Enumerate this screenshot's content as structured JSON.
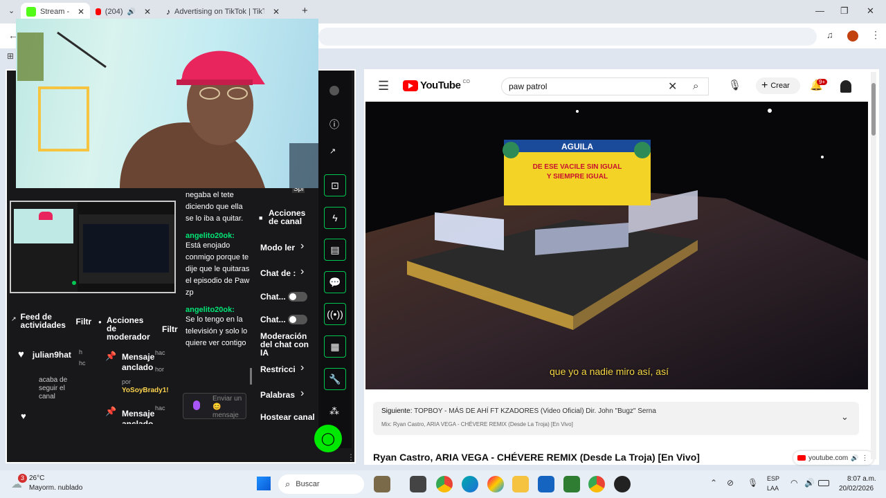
{
  "browser": {
    "tabs": [
      {
        "label": "Stream -"
      },
      {
        "label": "(204)"
      },
      {
        "label": "Advertising on TikTok | TikTok A"
      }
    ],
    "new_tab": "+"
  },
  "webcam_overlay": {
    "cap_color": "#e8255d"
  },
  "stream_panel": {
    "chat_messages_top": "negaba el tete diciendo que ella se lo iba a quitar.",
    "chat": [
      {
        "user": "angelito20ok:",
        "text": "Está enojado conmigo porque te dije que le quitaras el episodio de Paw zp"
      },
      {
        "user": "angelito20ok:",
        "text": "Se lo tengo en la televisión y solo lo quiere ver contigo"
      }
    ],
    "chat_placeholder": "Enviar un 😊 mensaje",
    "activity_feed": {
      "title": "Feed de actividades",
      "filter": "Filtr",
      "user": "julian9hat",
      "time": "h",
      "time2": "hc",
      "action": "acaba de seguir el canal"
    },
    "mod_actions": {
      "title": "Acciones de moderador",
      "filter": "Filtr",
      "items": [
        {
          "label": "Mensaje anclado",
          "time": "hac",
          "time2": "hor",
          "by": "por",
          "by_user": "YoSoyBrady1!"
        },
        {
          "label": "Mensaje anclado",
          "time": "hac"
        }
      ]
    },
    "channel_actions": {
      "title": "Acciones de canal",
      "items": [
        {
          "label": "Modo ler",
          "type": "arrow"
        },
        {
          "label": "Chat de :",
          "type": "arrow"
        },
        {
          "label": "Chat...",
          "type": "toggle"
        },
        {
          "label": "Chat...",
          "type": "toggle"
        },
        {
          "label": "Moderación del chat con IA",
          "type": "none"
        },
        {
          "label": "Restricci",
          "type": "arrow"
        },
        {
          "label": "Palabras",
          "type": "arrow"
        },
        {
          "label": "Hostear canal",
          "type": "none"
        }
      ]
    },
    "spi_label": "Spi"
  },
  "youtube": {
    "logo_text": "YouTube",
    "country_code": "CO",
    "search_value": "paw patrol",
    "create_label": "Crear",
    "notif_badge": "9+",
    "video_subtitle": "que yo a nadie miro así, así",
    "billboard_brand": "AGUILA",
    "billboard_line1": "DE ESE VACILE SIN IGUAL",
    "billboard_line2": "Y SIEMPRE IGUAL",
    "up_next_label": "Siguiente:",
    "up_next_title": "TOPBOY - MÁS DE AHÍ FT KZADORES (Video Oficial) Dir. John \"Bugz\" Serna",
    "up_next_mix": "Mix: Ryan Castro, ARIA VEGA - CHÉVERE REMIX (Desde La Troja) [En Vivo]",
    "video_title": "Ryan Castro, ARIA VEGA - CHÉVERE REMIX (Desde La Troja) [En Vivo]",
    "domain": "youtube.com"
  },
  "taskbar": {
    "weather_temp": "26°C",
    "weather_desc": "Mayorm. nublado",
    "weather_badge": "3",
    "search_label": "Buscar",
    "lang1": "ESP",
    "lang2": "LAA",
    "time": "8:07 a.m.",
    "date": "20/02/2026"
  }
}
